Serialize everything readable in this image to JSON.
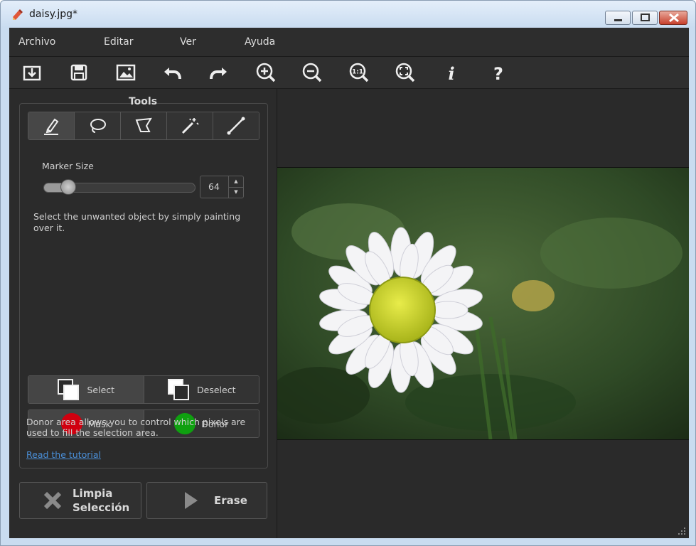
{
  "window": {
    "title": "daisy.jpg*"
  },
  "menu": [
    "Archivo",
    "Editar",
    "Ver",
    "Ayuda"
  ],
  "toolbar": {
    "icons": [
      "open-icon",
      "save-icon",
      "image-icon",
      "undo-icon",
      "redo-icon",
      "zoom-in-icon",
      "zoom-out-icon",
      "zoom-actual-icon",
      "zoom-fit-icon",
      "info-icon",
      "help-icon"
    ],
    "zoom_actual_text": "1:1",
    "info_text": "i",
    "help_text": "?"
  },
  "tools": {
    "title": "Tools",
    "items": [
      "marker-icon",
      "lasso-icon",
      "polygon-lasso-icon",
      "magic-wand-icon",
      "line-icon"
    ],
    "active_index": 0,
    "marker_size_label": "Marker Size",
    "marker_size": 64,
    "marker_size_fraction": 0.16,
    "help_text": "Select the unwanted object by simply painting over it."
  },
  "selection": {
    "select": "Select",
    "deselect": "Deselect"
  },
  "areas": {
    "mask": "Mask",
    "donor": "Donor",
    "mask_color": "#d0000f",
    "donor_color": "#0fa010",
    "help_text": "Donor area allows you to control which pixels are used to fill the selection area.",
    "tutorial_link": "Read the tutorial"
  },
  "actions": {
    "limpia_line1": "Limpia",
    "limpia_line2": "Selección",
    "erase": "Erase"
  }
}
